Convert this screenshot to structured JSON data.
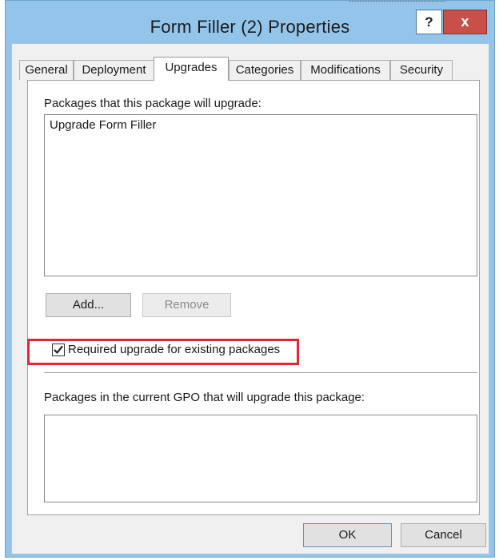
{
  "window": {
    "title": "Form Filler (2) Properties",
    "help_label": "?",
    "close_label": "x"
  },
  "tabs": [
    {
      "label": "General"
    },
    {
      "label": "Deployment"
    },
    {
      "label": "Upgrades"
    },
    {
      "label": "Categories"
    },
    {
      "label": "Modifications"
    },
    {
      "label": "Security"
    }
  ],
  "upgrades": {
    "upgrade_list_label": "Packages that this package will upgrade:",
    "upgrade_list_items": [
      "Upgrade Form Filler"
    ],
    "add_label": "Add...",
    "remove_label": "Remove",
    "required_checkbox_label": "Required upgrade for existing packages",
    "required_checked": true,
    "gpo_list_label": "Packages in the current GPO that will upgrade this package:",
    "gpo_list_items": []
  },
  "footer": {
    "ok_label": "OK",
    "cancel_label": "Cancel"
  }
}
